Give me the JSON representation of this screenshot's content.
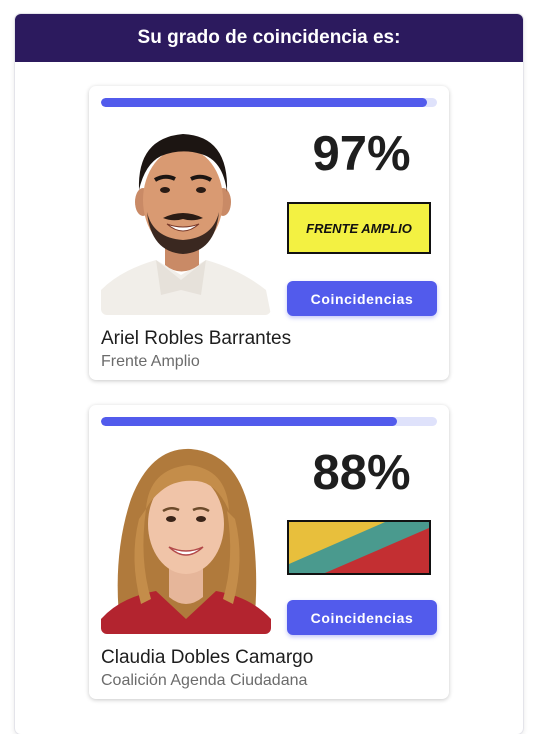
{
  "header": {
    "title": "Su grado de coincidencia es:"
  },
  "candidates": [
    {
      "name": "Ariel Robles Barrantes",
      "party": "Frente Amplio",
      "percent": "97%",
      "match_fraction": 0.97,
      "party_logo_text": "FRENTE AMPLIO",
      "button_label": "Coincidencias"
    },
    {
      "name": "Claudia Dobles Camargo",
      "party": "Coalición Agenda Ciudadana",
      "percent": "88%",
      "match_fraction": 0.88,
      "party_logo_text": "",
      "button_label": "Coincidencias"
    }
  ],
  "colors": {
    "header_bg": "#2c1a5e",
    "accent": "#525bec",
    "progress_track": "#dfe2fb",
    "fa_logo_bg": "#f3f142",
    "agenda_logo_yellow": "#e8bf3c",
    "agenda_logo_teal": "#4a9a8e",
    "agenda_logo_red": "#c32f32"
  }
}
